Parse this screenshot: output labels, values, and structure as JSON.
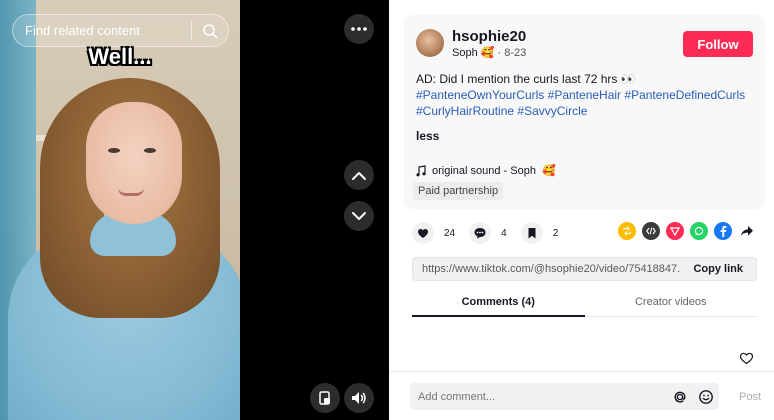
{
  "video": {
    "search_placeholder": "Find related content",
    "caption": "Well..."
  },
  "post": {
    "username": "hsophie20",
    "display_name": "Soph",
    "date": "· 8-23",
    "follow_label": "Follow",
    "description_prefix": "AD: Did I mention the curls last 72 hrs",
    "hashtags": [
      "#PanteneOwnYourCurls",
      "#PanteneHair",
      "#PanteneDefinedCurls",
      "#CurlyHairRoutine",
      "#SavvyCircle"
    ],
    "less_label": "less",
    "sound": "original sound - Soph",
    "paid_label": "Paid partnership"
  },
  "actions": {
    "likes": "24",
    "comments": "4",
    "saves": "2"
  },
  "link": {
    "url": "https://www.tiktok.com/@hsophie20/video/75418847...",
    "copy_label": "Copy link"
  },
  "tabs": {
    "comments": "Comments (4)",
    "creator_videos": "Creator videos"
  },
  "comment_input": {
    "placeholder": "Add comment...",
    "post_label": "Post"
  },
  "colors": {
    "accent": "#fe2c55",
    "hashtag": "#2b5db9"
  }
}
